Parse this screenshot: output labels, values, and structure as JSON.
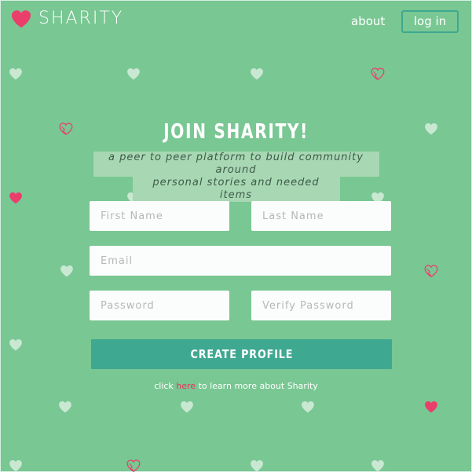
{
  "header": {
    "brand": "SHARITY",
    "nav_about": "about",
    "login_label": "log in"
  },
  "form": {
    "title": "JOIN SHARITY!",
    "subtitle_line1": "a peer to peer platform to build community around",
    "subtitle_line2": "personal stories and needed items",
    "first_name_placeholder": "First Name",
    "last_name_placeholder": "Last Name",
    "email_placeholder": "Email",
    "password_placeholder": "Password",
    "verify_password_placeholder": "Verify Password",
    "submit_label": "CREATE PROFILE"
  },
  "footer": {
    "prefix": "click",
    "link_text": "here",
    "suffix": "to learn more about Sharity"
  },
  "colors": {
    "background": "#79c793",
    "accent": "#3ea890",
    "heart_pink": "#ea3e6b",
    "link": "#e8325a"
  },
  "icons": {
    "brand": "heart-icon",
    "background_pattern": [
      "heart-icon",
      "broken-heart-icon"
    ]
  }
}
